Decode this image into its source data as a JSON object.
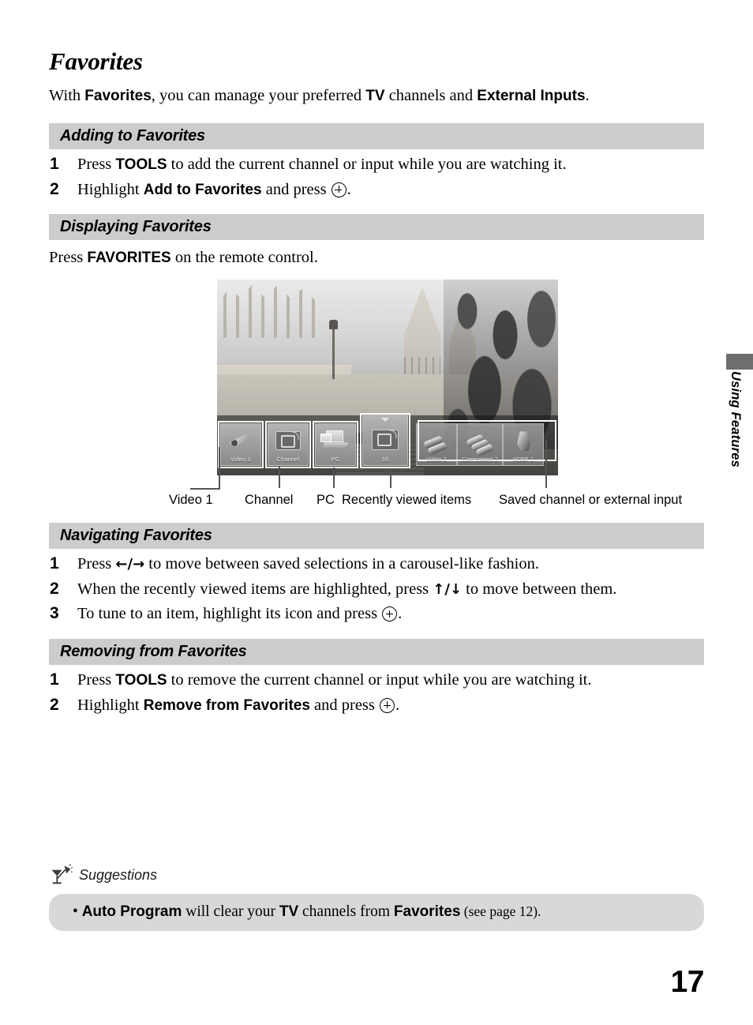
{
  "document": {
    "page_title": "Favorites",
    "page_number": "17",
    "side_tab_label": "Using Features",
    "intro": {
      "part1": "With ",
      "bold1": "Favorites",
      "part2": ", you can manage your preferred ",
      "bold2": "TV",
      "part3": " channels and ",
      "bold3": "External Inputs",
      "part4": "."
    }
  },
  "sections": [
    {
      "id": "adding",
      "heading": "Adding to Favorites",
      "steps": [
        {
          "num": "1",
          "pre": "Press ",
          "bold": "TOOLS",
          "post": " to add the current channel or input while you are watching it."
        },
        {
          "num": "2",
          "pre": "Highlight ",
          "bold": "Add to Favorites",
          "post": " and press ",
          "icon": "enter-button-icon",
          "tail": "."
        }
      ]
    },
    {
      "id": "displaying",
      "heading": "Displaying Favorites",
      "lead_line": {
        "pre": "Press ",
        "bold": "FAVORITES",
        "post": " on the remote control."
      }
    },
    {
      "id": "navigating",
      "heading": "Navigating Favorites",
      "steps": [
        {
          "num": "1",
          "pre": "Press ",
          "arrows": "←/→",
          "post": " to move between saved selections in a carousel-like fashion."
        },
        {
          "num": "2",
          "pre": "When the recently viewed items are highlighted, press ",
          "arrows": "↑/↓",
          "post": " to move between them."
        },
        {
          "num": "3",
          "pre": "To tune to an item, highlight its icon and press ",
          "icon": "enter-button-icon",
          "tail": "."
        }
      ]
    },
    {
      "id": "removing",
      "heading": "Removing from Favorites",
      "steps": [
        {
          "num": "1",
          "pre": "Press ",
          "bold": "TOOLS",
          "post": " to remove the current channel or input while you are watching it."
        },
        {
          "num": "2",
          "pre": "Highlight ",
          "bold": "Remove from Favorites",
          "post": " and press ",
          "icon": "enter-button-icon",
          "tail": "."
        }
      ]
    }
  ],
  "figure": {
    "carousel_tiles": [
      {
        "label": "Video 1",
        "icon": "composite-video-plug-icon",
        "selected": false
      },
      {
        "label": "Channel",
        "icon": "tv-antenna-icon",
        "selected": false
      },
      {
        "label": "PC",
        "icon": "laptop-icon",
        "selected": false
      },
      {
        "label": "16",
        "icon": "tv-antenna-icon",
        "selected": true
      },
      {
        "label": "Video 2",
        "icon": "dual-video-plug-icon",
        "selected": false
      },
      {
        "label": "Component 2",
        "icon": "triple-component-plug-icon",
        "selected": false
      },
      {
        "label": "HDMI 1",
        "icon": "hdmi-plug-icon",
        "selected": false
      }
    ],
    "callouts": [
      {
        "id": "video1",
        "label": "Video 1"
      },
      {
        "id": "channel",
        "label": "Channel"
      },
      {
        "id": "pc",
        "label": "PC"
      },
      {
        "id": "recent",
        "label": "Recently viewed items"
      },
      {
        "id": "saved",
        "label": "Saved channel or external input"
      }
    ]
  },
  "suggestions": {
    "title": "Suggestions",
    "icon": "desk-lamp-icon",
    "items": [
      {
        "bullet": "• ",
        "bold1": "Auto Program",
        "mid1": " will clear your ",
        "bold2": "TV",
        "mid2": " channels from ",
        "bold3": "Favorites",
        "tail": " (see page 12)."
      }
    ]
  },
  "colors": {
    "section_bar": "#cccccc",
    "suggestion_box": "#d8d8d8",
    "side_tab": "#6e6e6e"
  }
}
